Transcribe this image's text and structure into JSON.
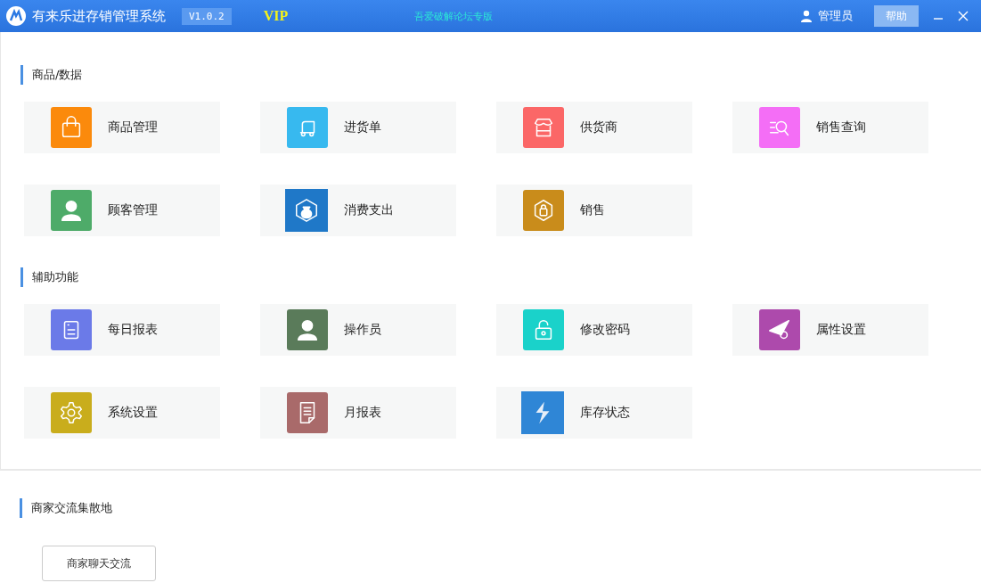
{
  "window": {
    "title": "有来乐进存销管理系统",
    "version": "V1.0.2",
    "edition": "VIP",
    "notice": "吾爱破解论坛专版",
    "user": "管理员",
    "help_button": "帮助"
  },
  "sections": [
    {
      "title": "商品/数据",
      "tiles": [
        {
          "label": "商品管理",
          "kind": "bag",
          "color": "#fb8a0c"
        },
        {
          "label": "进货单",
          "kind": "truck",
          "color": "#37b9ef"
        },
        {
          "label": "供货商",
          "kind": "store",
          "color": "#fb6767"
        },
        {
          "label": "销售查询",
          "kind": "search",
          "color": "#f46ef6"
        },
        {
          "label": "顾客管理",
          "kind": "person",
          "color": "#4eab69"
        },
        {
          "label": "消费支出",
          "kind": "moneybag",
          "color": "#1f78c8"
        },
        {
          "label": "销售",
          "kind": "hexbag",
          "color": "#c98c1b"
        }
      ]
    },
    {
      "title": "辅助功能",
      "tiles": [
        {
          "label": "每日报表",
          "kind": "report",
          "color": "#6b7ae8"
        },
        {
          "label": "操作员",
          "kind": "person",
          "color": "#5a7b5a"
        },
        {
          "label": "修改密码",
          "kind": "lock",
          "color": "#1ad2ca"
        },
        {
          "label": "属性设置",
          "kind": "plane",
          "color": "#ad4aac"
        },
        {
          "label": "系统设置",
          "kind": "gear",
          "color": "#c9ad1c"
        },
        {
          "label": "月报表",
          "kind": "document",
          "color": "#a96a6a"
        },
        {
          "label": "库存状态",
          "kind": "bolt",
          "color": "#2f86d6"
        }
      ]
    }
  ],
  "community": {
    "title": "商家交流集散地",
    "button": "商家聊天交流"
  }
}
